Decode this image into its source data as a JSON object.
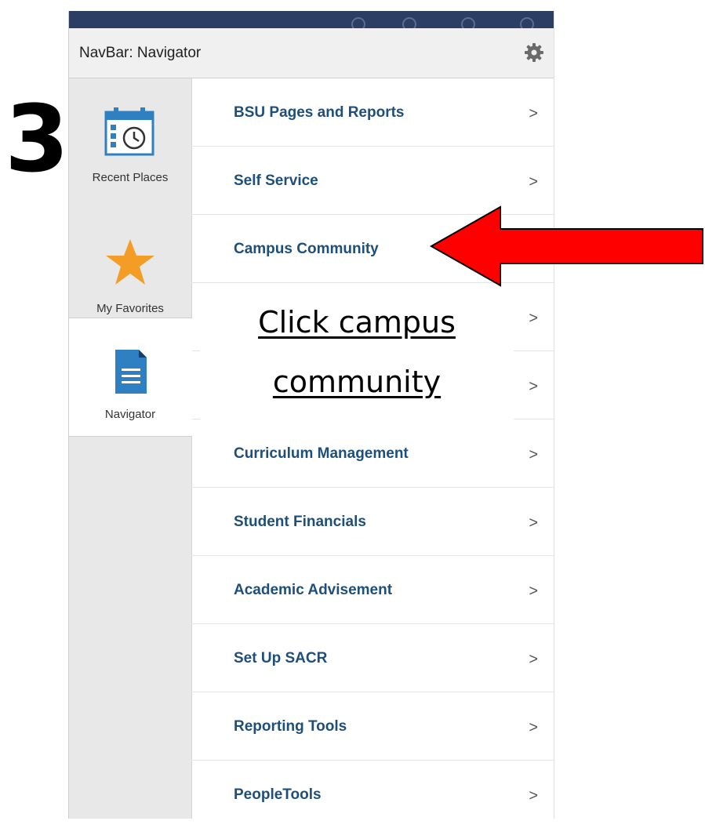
{
  "step_number": "3",
  "header": {
    "title": "NavBar: Navigator",
    "settings_icon": "gear-icon"
  },
  "sidebar": {
    "items": [
      {
        "label": "Recent Places",
        "icon": "calendar-clock-icon"
      },
      {
        "label": "My Favorites",
        "icon": "star-icon"
      },
      {
        "label": "Navigator",
        "icon": "document-icon",
        "active": true
      }
    ]
  },
  "menu": {
    "items": [
      {
        "label": "BSU Pages and Reports",
        "chevron": ">"
      },
      {
        "label": "Self Service",
        "chevron": ">"
      },
      {
        "label": "Campus Community",
        "chevron": ""
      },
      {
        "label": "",
        "chevron": ">"
      },
      {
        "label": "",
        "chevron": ">"
      },
      {
        "label": "Curriculum Management",
        "chevron": ">"
      },
      {
        "label": "Student Financials",
        "chevron": ">"
      },
      {
        "label": "Academic Advisement",
        "chevron": ">"
      },
      {
        "label": "Set Up SACR",
        "chevron": ">"
      },
      {
        "label": "Reporting Tools",
        "chevron": ">"
      },
      {
        "label": "PeopleTools",
        "chevron": ">"
      }
    ]
  },
  "annotation": {
    "line1": "Click campus",
    "line2": "community",
    "arrow_color": "#ff0000"
  },
  "colors": {
    "menu_text": "#1e4f7a",
    "star": "#f39c26",
    "icon_blue": "#2f80c3",
    "topbar": "#2c3e63"
  }
}
